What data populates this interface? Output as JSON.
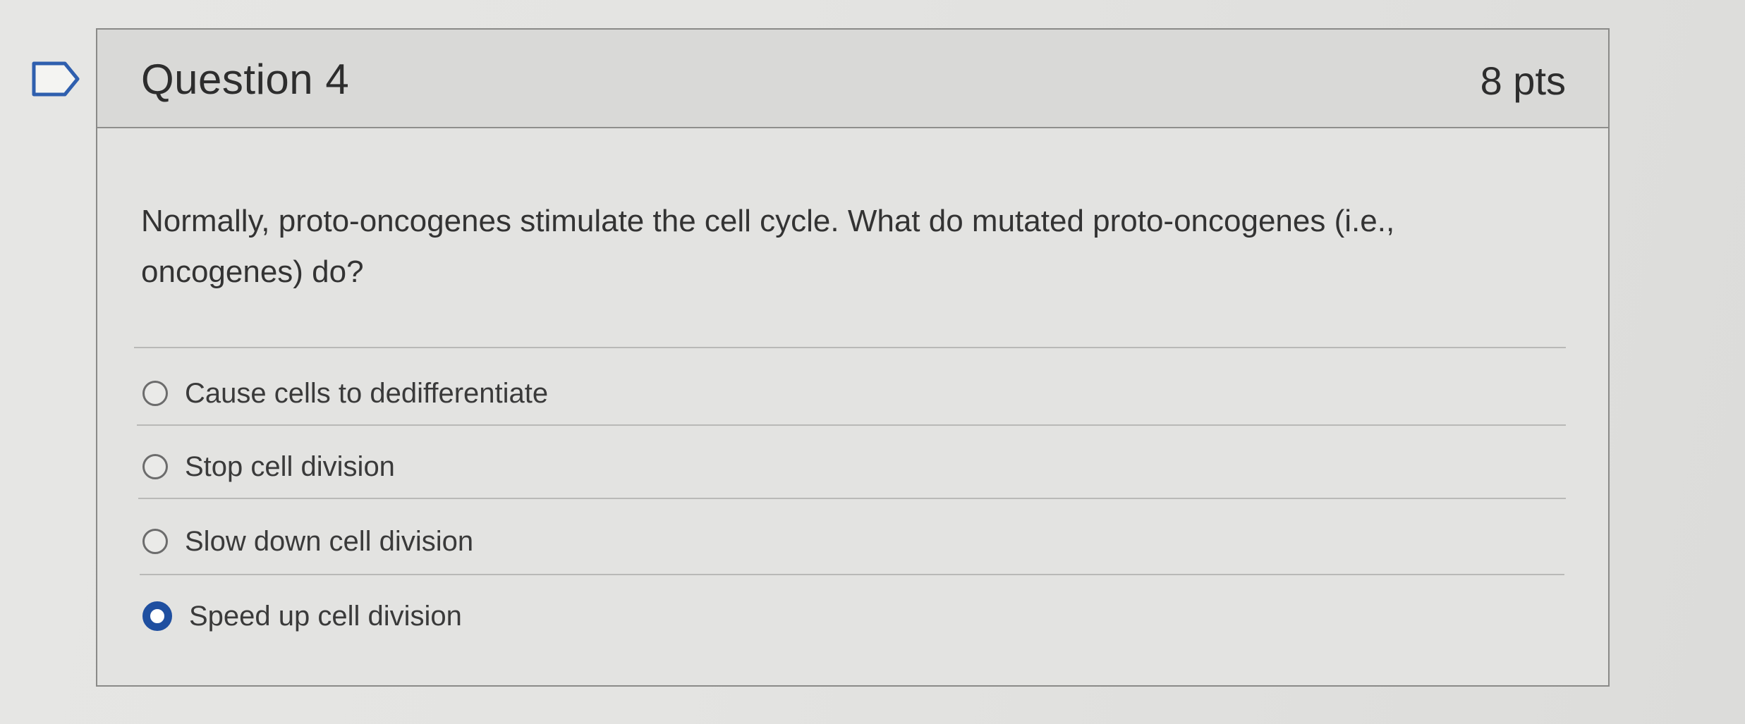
{
  "question": {
    "title": "Question 4",
    "points": "8 pts",
    "text": "Normally, proto-oncogenes stimulate the cell cycle. What do mutated proto-oncogenes (i.e., oncogenes) do?",
    "flag_icon": "flag-outline-icon"
  },
  "answers": [
    {
      "label": "Cause cells to dedifferentiate",
      "selected": false
    },
    {
      "label": "Stop cell division",
      "selected": false
    },
    {
      "label": "Slow down cell division",
      "selected": false
    },
    {
      "label": "Speed up cell division",
      "selected": true
    }
  ],
  "colors": {
    "selected_radio": "#1f4fa0",
    "header_bg": "#d9d9d7",
    "text": "#333333"
  }
}
